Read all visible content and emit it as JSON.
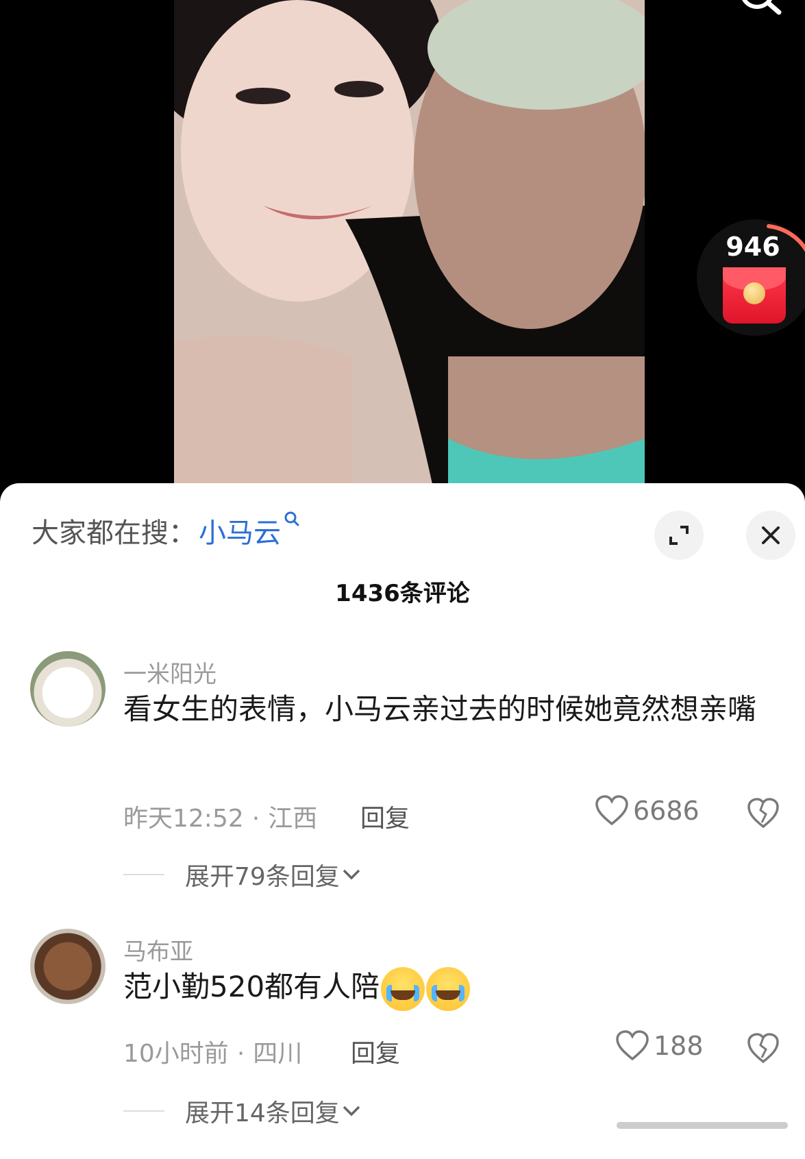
{
  "redpacket": {
    "count": "946"
  },
  "sheet": {
    "hot_search_label": "大家都在搜：",
    "hot_search_term": "小马云",
    "comment_count": "1436条评论"
  },
  "comments": [
    {
      "username": "一米阳光",
      "text": "看女生的表情，小马云亲过去的时候她竟然想亲嘴",
      "time": "昨天12:52",
      "location": "江西",
      "reply": "回复",
      "likes": "6686",
      "expand": "展开79条回复"
    },
    {
      "username": "马布亚",
      "text": "范小勤520都有人陪",
      "time": "10小时前",
      "location": "四川",
      "reply": "回复",
      "likes": "188",
      "expand": "展开14条回复"
    }
  ]
}
